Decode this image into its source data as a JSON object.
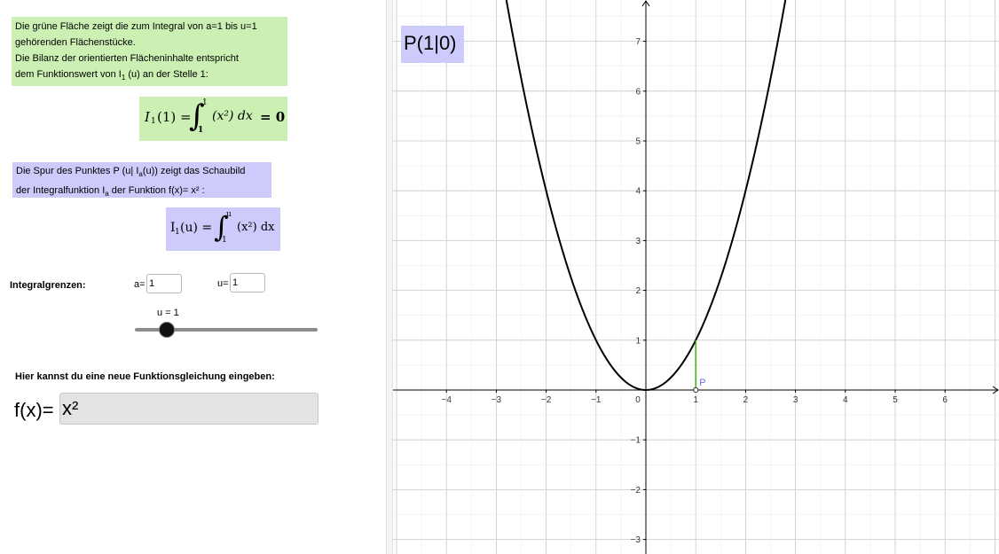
{
  "left_panel": {
    "green_text": {
      "line1": "Die grüne Fläche zeigt die zum Integral von a=1  bis u=1",
      "line2": "gehörenden Flächenstücke.",
      "line3": "Die Bilanz der orientierten Flächeninhalte entspricht",
      "line4_pre": "dem Funktionswert von I",
      "line4_sub": "1",
      "line4_post": " (u) an der Stelle 1:"
    },
    "formula1": {
      "lhs": "I",
      "lhs_sub": "1",
      "lhs_arg": "(1) =",
      "upper": "1",
      "lower": "1",
      "integrand": "(x²) dx",
      "result": "= 0"
    },
    "blue_text": {
      "line1_pre": "Die Spur des Punktes P (u| I",
      "line1_sub": "a",
      "line1_post": "(u)) zeigt das Schaubild",
      "line2_pre": "der Integralfunktion I",
      "line2_sub": "a",
      "line2_post": " der Funktion f(x)= x² :"
    },
    "formula2": {
      "lhs": "I",
      "lhs_sub": "1",
      "lhs_arg": "(u) =",
      "upper": "u",
      "lower": "1",
      "integrand": "(x²) dx"
    },
    "limits_label": "Integralgrenzen:",
    "a_label": "a=",
    "a_value": "1",
    "u_label": "u=",
    "u_value": "1",
    "slider_label": "u = 1",
    "slider_value": 1,
    "new_function_label": "Hier kannst du eine neue Funktionsgleichung eingeben:",
    "fx_label": "f(x)=",
    "fx_value": "x²"
  },
  "graph": {
    "point_label": "P(1|0)",
    "point_name": "P",
    "x_ticks": [
      "−4",
      "−3",
      "−2",
      "−1",
      "0",
      "1",
      "2",
      "3",
      "4",
      "5",
      "6"
    ],
    "y_ticks": [
      "7",
      "6",
      "5",
      "4",
      "3",
      "2",
      "1",
      "−1",
      "−2",
      "−3"
    ],
    "x_range": [
      -5.1,
      7.0
    ],
    "y_range": [
      -3.3,
      7.8
    ],
    "function": "x^2",
    "area_color": "#3cb400",
    "point_color": "#7070d0"
  }
}
